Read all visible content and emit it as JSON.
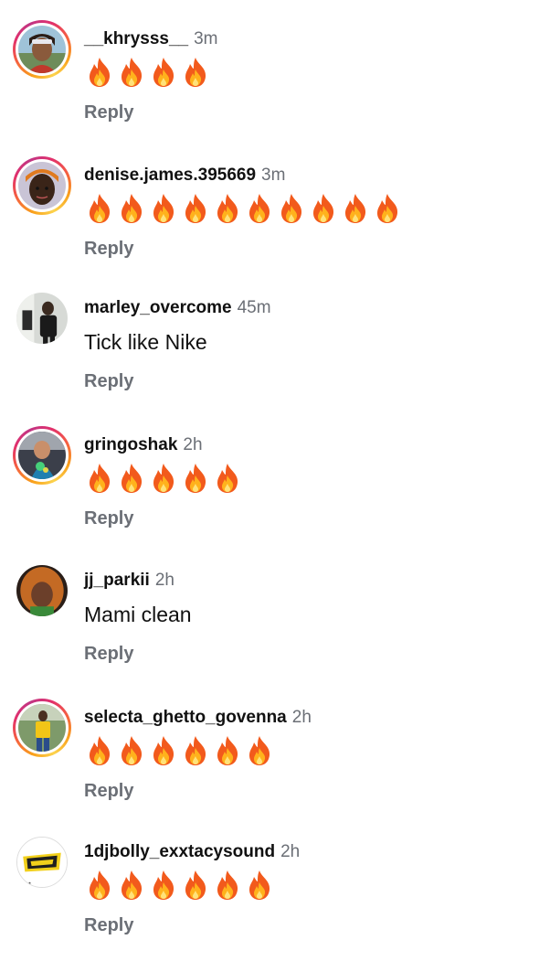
{
  "comments": [
    {
      "username": "__khrysss__",
      "time": "3m",
      "text": "",
      "flame_count": 4,
      "has_story_ring": true,
      "reply_label": "Reply"
    },
    {
      "username": "denise.james.395669",
      "time": "3m",
      "text": "",
      "flame_count": 10,
      "has_story_ring": true,
      "reply_label": "Reply"
    },
    {
      "username": "marley_overcome",
      "time": "45m",
      "text": "Tick like Nike",
      "flame_count": 0,
      "has_story_ring": false,
      "reply_label": "Reply"
    },
    {
      "username": "gringoshak",
      "time": "2h",
      "text": "",
      "flame_count": 5,
      "has_story_ring": true,
      "reply_label": "Reply"
    },
    {
      "username": "jj_parkii",
      "time": "2h",
      "text": "Mami clean",
      "flame_count": 0,
      "has_story_ring": false,
      "reply_label": "Reply"
    },
    {
      "username": "selecta_ghetto_govenna",
      "time": "2h",
      "text": "",
      "flame_count": 6,
      "has_story_ring": true,
      "reply_label": "Reply"
    },
    {
      "username": "1djbolly_exxtacysound",
      "time": "2h",
      "text": "",
      "flame_count": 6,
      "has_story_ring": false,
      "reply_label": "Reply"
    }
  ],
  "icons": {
    "flame": "fire-emoji-icon",
    "avatar": "profile-avatar"
  },
  "colors": {
    "text_primary": "#111111",
    "text_secondary": "#6b6f76",
    "story_ring_start": "#f9a01b",
    "story_ring_mid": "#e1306c",
    "story_ring_end": "#c13584"
  }
}
